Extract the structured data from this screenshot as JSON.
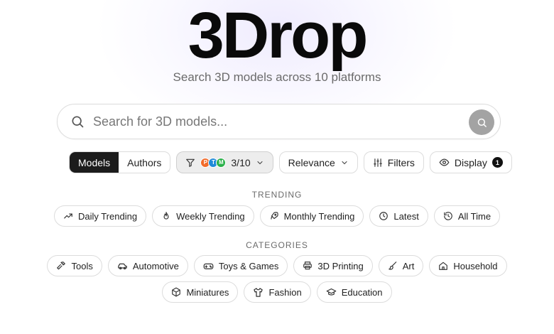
{
  "brand": {
    "logo": "3Drop",
    "tagline": "Search 3D models across 10 platforms"
  },
  "search": {
    "placeholder": "Search for 3D models..."
  },
  "toolbar": {
    "modes": [
      {
        "label": "Models",
        "active": true
      },
      {
        "label": "Authors",
        "active": false
      }
    ],
    "sources": {
      "count": "3/10",
      "badges": [
        {
          "letter": "P",
          "color": "#f26b2a"
        },
        {
          "letter": "T",
          "color": "#1f8ad8"
        },
        {
          "letter": "M",
          "color": "#2bb14a"
        }
      ]
    },
    "sort_label": "Relevance",
    "filters_label": "Filters",
    "display_label": "Display",
    "display_count": "1"
  },
  "trending": {
    "title": "TRENDING",
    "items": [
      {
        "label": "Daily Trending",
        "icon": "trending-up-icon"
      },
      {
        "label": "Weekly Trending",
        "icon": "flame-icon"
      },
      {
        "label": "Monthly Trending",
        "icon": "rocket-icon"
      },
      {
        "label": "Latest",
        "icon": "clock-icon"
      },
      {
        "label": "All Time",
        "icon": "history-icon"
      }
    ]
  },
  "categories": {
    "title": "CATEGORIES",
    "row1": [
      {
        "label": "Tools",
        "icon": "hammer-icon"
      },
      {
        "label": "Automotive",
        "icon": "car-icon"
      },
      {
        "label": "Toys & Games",
        "icon": "gamepad-icon"
      },
      {
        "label": "3D Printing",
        "icon": "printer-icon"
      },
      {
        "label": "Art",
        "icon": "brush-icon"
      },
      {
        "label": "Household",
        "icon": "home-icon"
      }
    ],
    "row2": [
      {
        "label": "Miniatures",
        "icon": "cube-icon"
      },
      {
        "label": "Fashion",
        "icon": "shirt-icon"
      },
      {
        "label": "Education",
        "icon": "graduation-cap-icon"
      }
    ]
  },
  "colors": {
    "accent_dark": "#1c1c1c",
    "search_button": "#a3a3a3",
    "glow": "#ede9fe"
  }
}
